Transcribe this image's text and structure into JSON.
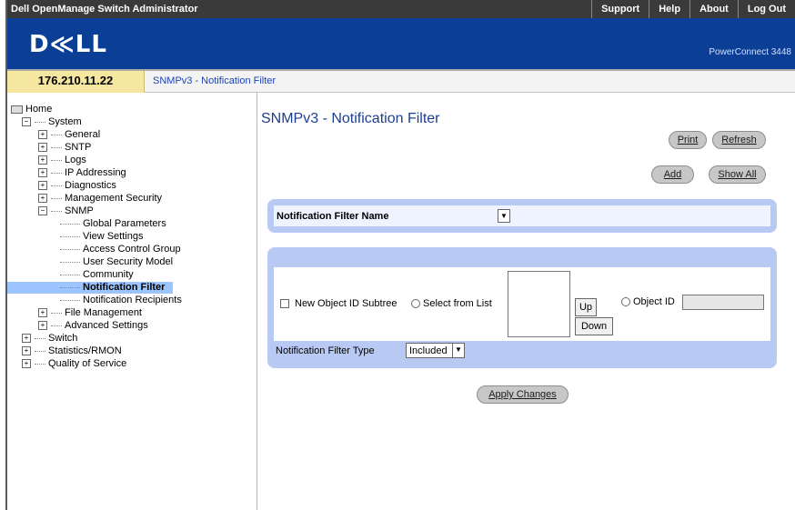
{
  "header": {
    "app_title": "Dell OpenManage Switch Administrator",
    "nav": [
      "Support",
      "Help",
      "About",
      "Log Out"
    ],
    "logo": "D≪LL",
    "product": "PowerConnect 3448"
  },
  "pathbar": {
    "ip": "176.210.11.22",
    "breadcrumb": "SNMPv3 - Notification Filter"
  },
  "tree": [
    {
      "label": "Home",
      "level": 0,
      "icon": "home"
    },
    {
      "label": "System",
      "level": 1,
      "icon": "expander",
      "symbol": "−"
    },
    {
      "label": "General",
      "level": 2,
      "icon": "expander",
      "symbol": "+"
    },
    {
      "label": "SNTP",
      "level": 2,
      "icon": "expander",
      "symbol": "+"
    },
    {
      "label": "Logs",
      "level": 2,
      "icon": "expander",
      "symbol": "+"
    },
    {
      "label": "IP Addressing",
      "level": 2,
      "icon": "expander",
      "symbol": "+"
    },
    {
      "label": "Diagnostics",
      "level": 2,
      "icon": "expander",
      "symbol": "+"
    },
    {
      "label": "Management Security",
      "level": 2,
      "icon": "expander",
      "symbol": "+"
    },
    {
      "label": "SNMP",
      "level": 2,
      "icon": "expander",
      "symbol": "−"
    },
    {
      "label": "Global Parameters",
      "level": 3,
      "icon": "dash"
    },
    {
      "label": "View Settings",
      "level": 3,
      "icon": "dash"
    },
    {
      "label": "Access Control Group",
      "level": 3,
      "icon": "dash"
    },
    {
      "label": "User Security Model",
      "level": 3,
      "icon": "dash"
    },
    {
      "label": "Community",
      "level": 3,
      "icon": "dash"
    },
    {
      "label": "Notification Filter",
      "level": 3,
      "icon": "dash",
      "selected": true
    },
    {
      "label": "Notification Recipients",
      "level": 3,
      "icon": "dash"
    },
    {
      "label": "File Management",
      "level": 2,
      "icon": "expander",
      "symbol": "+"
    },
    {
      "label": "Advanced Settings",
      "level": 2,
      "icon": "expander",
      "symbol": "+"
    },
    {
      "label": "Switch",
      "level": 1,
      "icon": "expander",
      "symbol": "+"
    },
    {
      "label": "Statistics/RMON",
      "level": 1,
      "icon": "expander",
      "symbol": "+"
    },
    {
      "label": "Quality of Service",
      "level": 1,
      "icon": "expander",
      "symbol": "+"
    }
  ],
  "main": {
    "title": "SNMPv3 - Notification Filter",
    "buttons": {
      "print": "Print",
      "refresh": "Refresh",
      "add": "Add",
      "show_all": "Show All",
      "apply": "Apply Changes"
    },
    "filter_name_label": "Notification Filter Name",
    "new_object_subtree": "New Object ID Subtree",
    "select_from_list": "Select from List",
    "up": "Up",
    "down": "Down",
    "object_id": "Object ID",
    "filter_type_label": "Notification Filter Type",
    "filter_type_value": "Included"
  }
}
